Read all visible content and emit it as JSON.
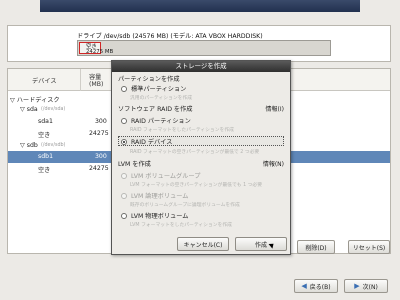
{
  "drive": {
    "title": "ドライブ /dev/sdb (24576 MB) (モデル: ATA VBOX HARDDISK)",
    "segment_label": "空き",
    "segment_size": "24275 MB"
  },
  "tree": {
    "columns": {
      "device": "デバイス",
      "size_line1": "容量",
      "size_line2": "(MB)"
    },
    "rows": [
      {
        "label": "▽ ハードディスク",
        "size": ""
      },
      {
        "label": "▽ sda",
        "path": "(/dev/sda)",
        "size": ""
      },
      {
        "label": "sda1",
        "size": "300"
      },
      {
        "label": "空き",
        "size": "24275"
      },
      {
        "label": "▽ sdb",
        "path": "(/dev/sdb)",
        "size": ""
      },
      {
        "label": "sdb1",
        "size": "300"
      },
      {
        "label": "空き",
        "size": "24275"
      }
    ]
  },
  "dialog": {
    "title": "ストレージを作成",
    "section_partition": "パーティションを作成",
    "opt_standard": "標準パーティション",
    "opt_standard_desc": "汎用のパーティションを作成",
    "section_raid": "ソフトウェア RAID を作成",
    "info_raid": "情報(I)",
    "opt_raid_partition": "RAID パーティション",
    "opt_raid_partition_desc": "RAID フォーマットをしたパーティションを作成",
    "opt_raid_device": "RAID デバイス",
    "opt_raid_device_desc": "RAID フォーマットの空きパーティションが最低で 2 つ必要",
    "section_lvm": "LVM を作成",
    "info_lvm": "情報(N)",
    "opt_lvm_vg": "LVM ボリュームグループ",
    "opt_lvm_vg_desc": "LVM フォーマットの空きパーティションが最低でも 1 つ必要",
    "opt_lvm_lv": "LVM 論理ボリューム",
    "opt_lvm_lv_desc": "既存のボリュームグループに論理ボリュームを作成",
    "opt_lvm_pv": "LVM 物理ボリューム",
    "opt_lvm_pv_desc": "LVM フォーマットをしたパーティションを作成",
    "cancel_label": "キャンセル(C)",
    "create_label": "作成"
  },
  "buttons": {
    "delete_label": "削除(D)",
    "reset_label": "リセット(S)",
    "back_label": "戻る(B)",
    "next_label": "次(N)"
  },
  "colors": {
    "selection": "#5f87b8",
    "segment_border": "#d02626",
    "titlebar": "#3a3a3a"
  }
}
